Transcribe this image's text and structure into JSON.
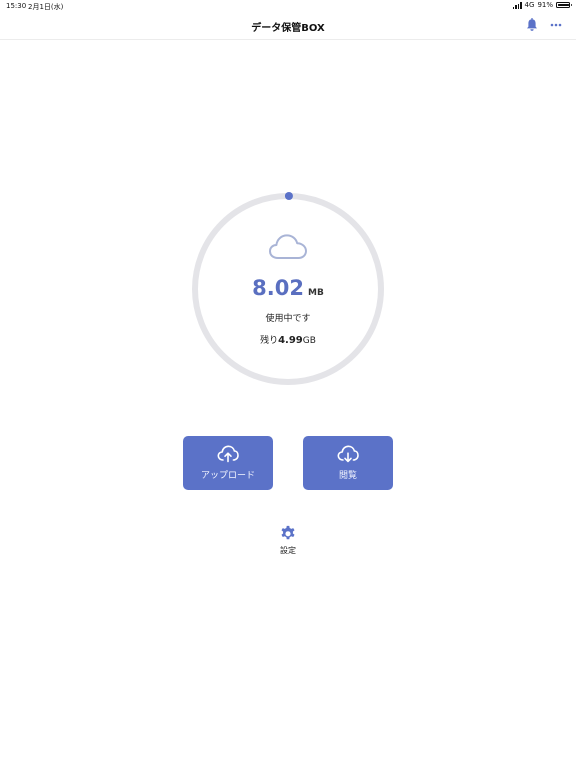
{
  "status_bar": {
    "time": "15:30",
    "date": "2月1日(水)",
    "network": "4G",
    "battery": "91%",
    "battery_level": 0.91
  },
  "nav": {
    "title": "データ保管BOX"
  },
  "storage": {
    "used_value": "8.02",
    "used_unit": "MB",
    "used_label": "使用中です",
    "remaining_prefix": "残り",
    "remaining_value": "4.99",
    "remaining_unit": "GB",
    "used_fraction": 0.0016
  },
  "actions": {
    "upload_label": "アップロード",
    "view_label": "閲覧"
  },
  "settings": {
    "label": "設定"
  },
  "colors": {
    "accent": "#5b72c8",
    "ring_track": "#e4e4e8",
    "cloud_outline": "#a9b4d6"
  }
}
